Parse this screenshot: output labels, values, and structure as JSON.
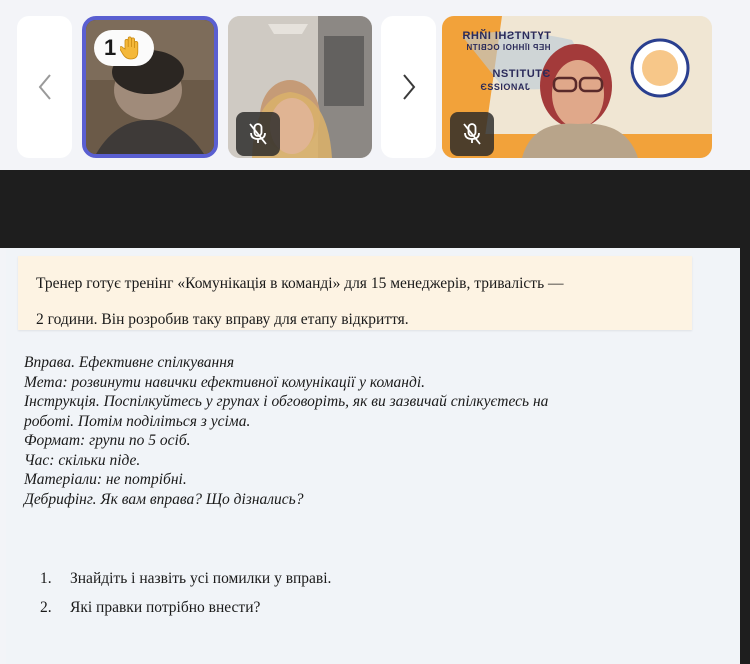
{
  "participants": {
    "tiles": [
      {
        "hand_count": "1",
        "hand_icon": "raised-hand-icon",
        "muted": false
      },
      {
        "muted": true,
        "mic_icon": "mic-off-icon"
      },
      {
        "muted": true,
        "mic_icon": "mic-off-icon",
        "banner_lines": [
          "ТҮТИТЅНІ ІЙНЯ",
          "НЕР ІЇННОІ ОСВІТИ",
          "ЭТUTITƧИ",
          "ЈАИОІƧƧЭ"
        ]
      }
    ],
    "prev_icon": "chevron-left-icon",
    "next_icon": "chevron-right-icon",
    "accent_color": "#5a5fd1"
  },
  "slide": {
    "callout_lines": [
      "Тренер готує тренінг «Комунікація в команді» для 15 менеджерів, тривалість —",
      "2 години. Він розробив таку вправу для етапу відкриття."
    ],
    "exercise_lines": [
      "Вправа. Ефективне спілкування",
      "Мета: розвинути навички ефективної комунікації у команді.",
      "Інструкція. Поспілкуйтесь у групах і обговоріть, як ви зазвичай спілкуєтесь на",
      "роботі. Потім поділіться з усіма.",
      "Формат: групи по 5 осіб.",
      "Час: скільки піде.",
      "Матеріали: не потрібні.",
      "Дебрифінг. Як вам вправа? Що дізнались?"
    ],
    "questions": [
      {
        "num": "1.",
        "text": "Знайдіть і назвіть усі помилки у вправі."
      },
      {
        "num": "2.",
        "text": "Які правки потрібно внести?"
      }
    ]
  }
}
